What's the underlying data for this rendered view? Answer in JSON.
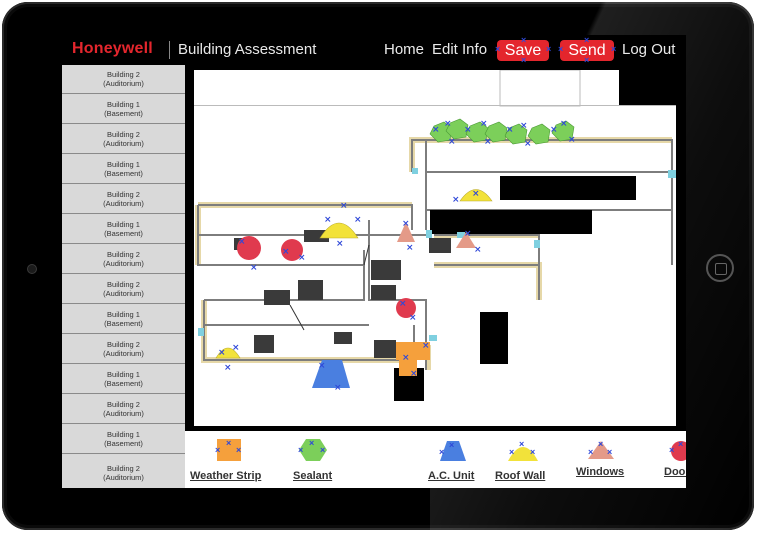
{
  "header": {
    "logo": "Honeywell",
    "app_title": "Building Assessment",
    "nav": {
      "home": "Home",
      "edit_info": "Edit Info",
      "save": "Save",
      "send": "Send",
      "logout": "Log Out"
    }
  },
  "sidebar": {
    "items": [
      {
        "line1": "Building 2",
        "line2": "(Auditorium)"
      },
      {
        "line1": "Building 1",
        "line2": "(Basement)"
      },
      {
        "line1": "Building 2",
        "line2": "(Auditorium)"
      },
      {
        "line1": "Building 1",
        "line2": "(Basement)"
      },
      {
        "line1": "Building 2",
        "line2": "(Auditorium)"
      },
      {
        "line1": "Building 1",
        "line2": "(Basement)"
      },
      {
        "line1": "Building 2",
        "line2": "(Auditorium)"
      },
      {
        "line1": "Building 2",
        "line2": "(Auditorium)"
      },
      {
        "line1": "Building 1",
        "line2": "(Basement)"
      },
      {
        "line1": "Building 2",
        "line2": "(Auditorium)"
      },
      {
        "line1": "Building 1",
        "line2": "(Basement)"
      },
      {
        "line1": "Building 2",
        "line2": "(Auditorium)"
      },
      {
        "line1": "Building 1",
        "line2": "(Basement)"
      },
      {
        "line1": "Building 2",
        "line2": "(Auditorium)"
      }
    ]
  },
  "legend": {
    "items": [
      {
        "label": "Weather Strip",
        "shape": "square",
        "color": "#f5a03c"
      },
      {
        "label": "Sealant",
        "shape": "hexagon",
        "color": "#7ccf5a"
      },
      {
        "label": "A.C. Unit",
        "shape": "trapezoid",
        "color": "#4a7fe0"
      },
      {
        "label": "Roof Wall",
        "shape": "dome",
        "color": "#f2e23a"
      },
      {
        "label": "Windows",
        "shape": "triangle",
        "color": "#e49a88"
      },
      {
        "label": "Doors",
        "shape": "circle",
        "color": "#e03a4e"
      }
    ]
  },
  "colors": {
    "brand_red": "#e4262d",
    "marker_x": "#2f48d8",
    "wall_tan": "#e6d8a8",
    "wall_gray": "#8a8a8a"
  }
}
